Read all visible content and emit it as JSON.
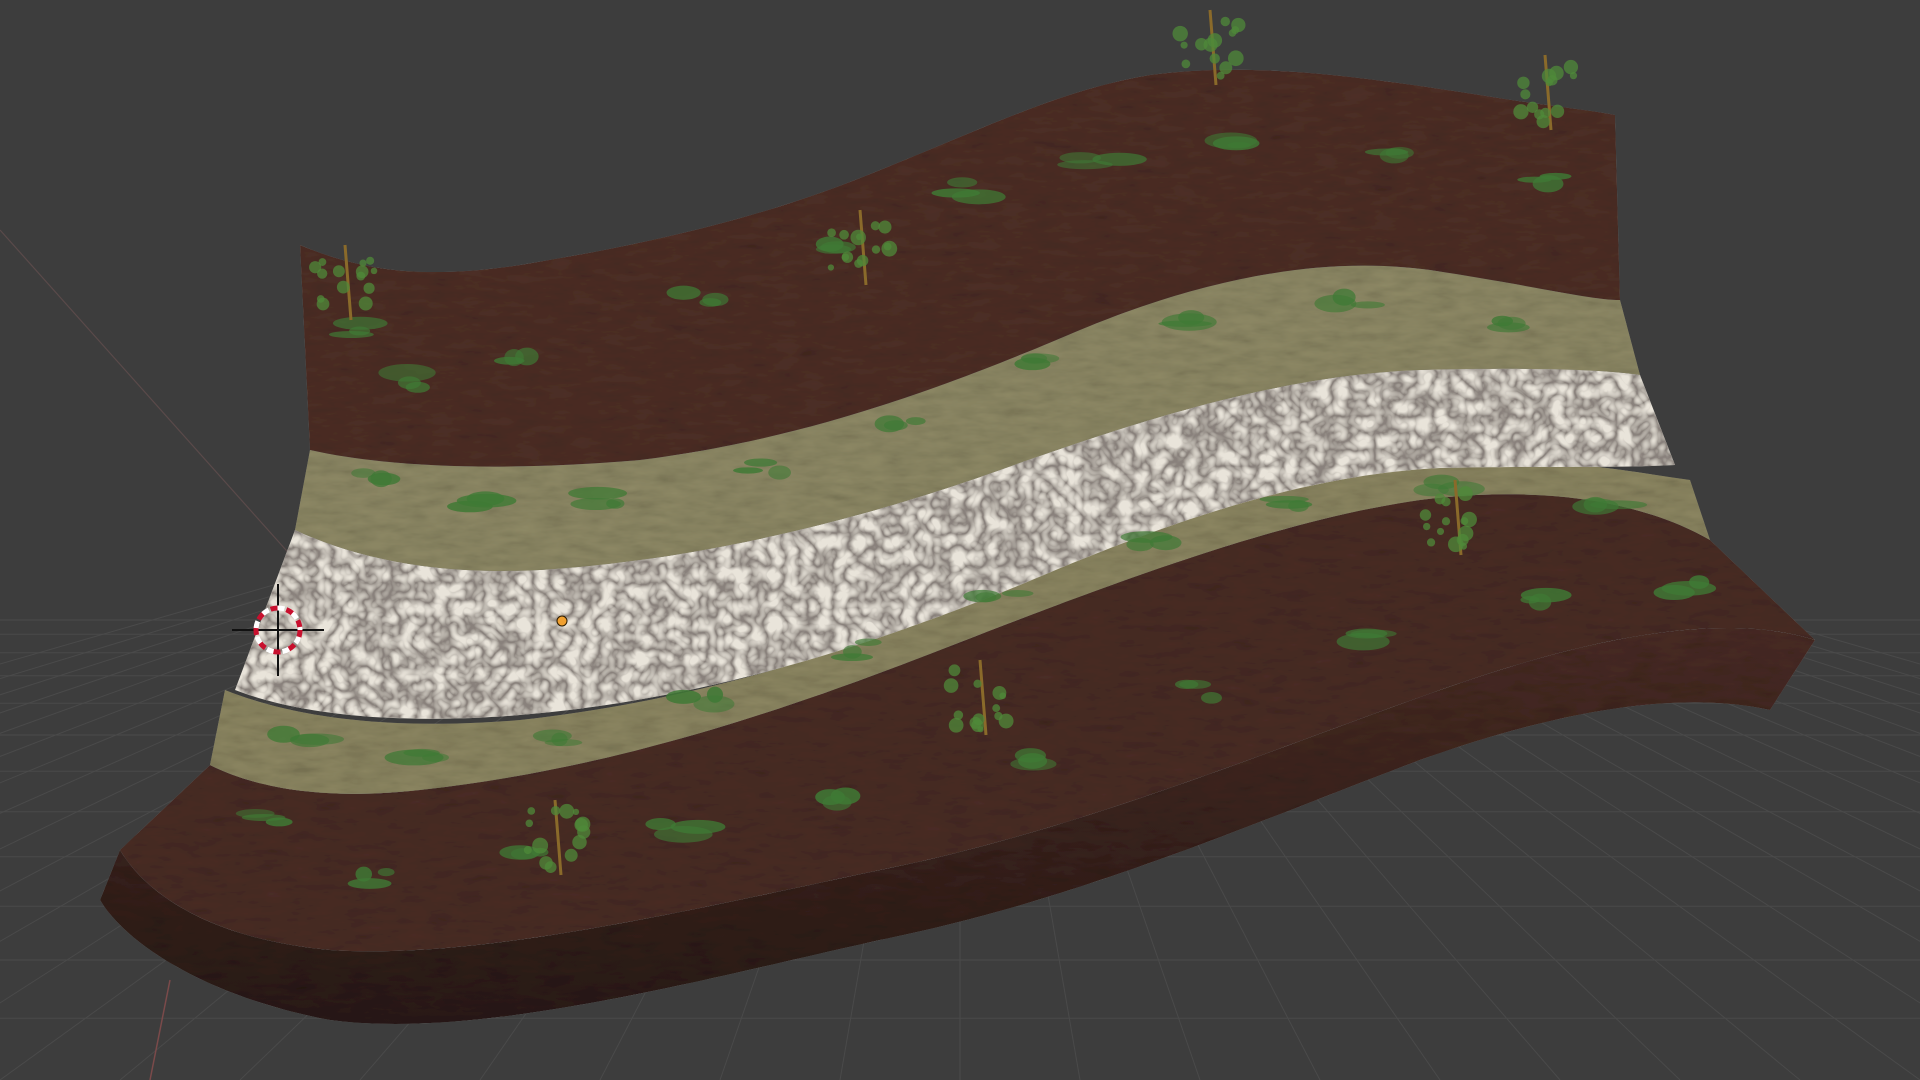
{
  "viewport": {
    "background_color": "#3d3d3d",
    "grid_color": "#4a4a4a"
  },
  "scene": {
    "terrain_object": {
      "layers": [
        {
          "name": "upper-earth-bank",
          "color": "#4e2f26"
        },
        {
          "name": "upper-grass-strip",
          "color": "#8f8a66"
        },
        {
          "name": "path-surface",
          "color": "#e9e4da"
        },
        {
          "name": "lower-grass-strip",
          "color": "#8d8762"
        },
        {
          "name": "lower-earth-bank",
          "color": "#4a2d25"
        }
      ],
      "moss_color": "#3f7a35",
      "tree_color": "#4f8a3a",
      "tree_count": 7
    },
    "origin_point_color": "#f0a030",
    "cursor_icon": "3d-cursor-icon",
    "cursor_colors": [
      "#c8102e",
      "#ffffff"
    ]
  }
}
